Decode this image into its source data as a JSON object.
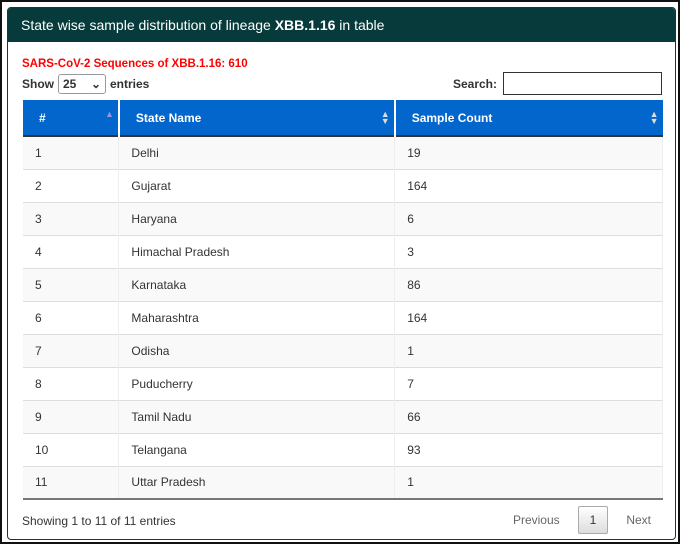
{
  "panel": {
    "title_prefix": "State wise sample distribution of lineage ",
    "title_lineage": "XBB.1.16",
    "title_suffix": " in table"
  },
  "summary": "SARS-CoV-2 Sequences of XBB.1.16: 610",
  "length": {
    "show": "Show",
    "value": "25",
    "entries": "entries"
  },
  "search": {
    "label": "Search:",
    "value": ""
  },
  "columns": [
    "#",
    "State Name",
    "Sample Count"
  ],
  "rows": [
    [
      "1",
      "Delhi",
      "19"
    ],
    [
      "2",
      "Gujarat",
      "164"
    ],
    [
      "3",
      "Haryana",
      "6"
    ],
    [
      "4",
      "Himachal Pradesh",
      "3"
    ],
    [
      "5",
      "Karnataka",
      "86"
    ],
    [
      "6",
      "Maharashtra",
      "164"
    ],
    [
      "7",
      "Odisha",
      "1"
    ],
    [
      "8",
      "Puducherry",
      "7"
    ],
    [
      "9",
      "Tamil Nadu",
      "66"
    ],
    [
      "10",
      "Telangana",
      "93"
    ],
    [
      "11",
      "Uttar Pradesh",
      "1"
    ]
  ],
  "info": "Showing 1 to 11 of 11 entries",
  "pagination": {
    "previous": "Previous",
    "current": "1",
    "next": "Next"
  },
  "colors": {
    "header": "#073a3a",
    "table_header": "#0266cc",
    "summary": "#ff0000"
  }
}
